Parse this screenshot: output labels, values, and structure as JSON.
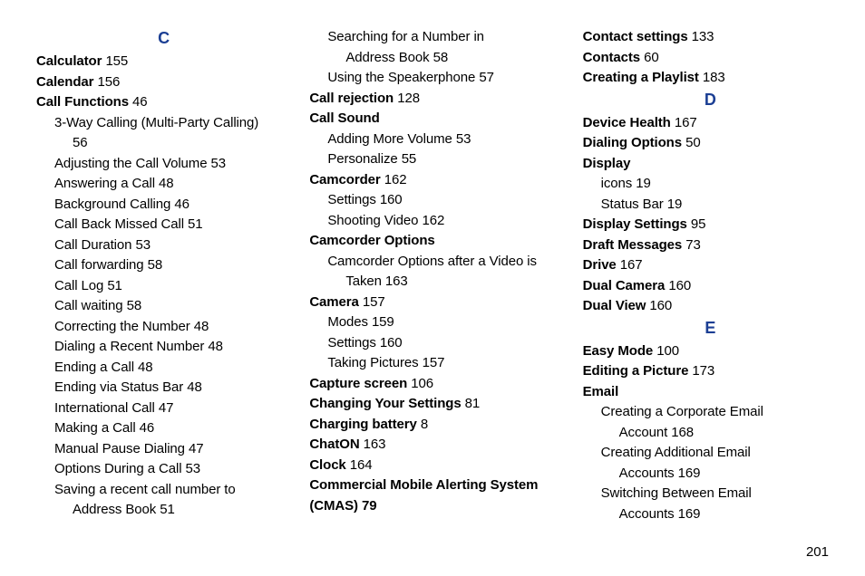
{
  "page_number": "201",
  "columns": [
    {
      "blocks": [
        {
          "type": "letter",
          "text": "C"
        },
        {
          "type": "term",
          "term": "Calculator",
          "page": "155"
        },
        {
          "type": "term",
          "term": "Calendar",
          "page": "156"
        },
        {
          "type": "term",
          "term": "Call Functions",
          "page": "46"
        },
        {
          "type": "sub-wrap",
          "lines": [
            "3-Way Calling (Multi-Party Calling)",
            "56"
          ]
        },
        {
          "type": "sub",
          "text": "Adjusting the Call Volume",
          "page": "53"
        },
        {
          "type": "sub",
          "text": "Answering a Call",
          "page": "48"
        },
        {
          "type": "sub",
          "text": "Background Calling",
          "page": "46"
        },
        {
          "type": "sub",
          "text": "Call Back Missed Call",
          "page": "51"
        },
        {
          "type": "sub",
          "text": "Call Duration",
          "page": "53"
        },
        {
          "type": "sub",
          "text": "Call forwarding",
          "page": "58"
        },
        {
          "type": "sub",
          "text": "Call Log",
          "page": "51"
        },
        {
          "type": "sub",
          "text": "Call waiting",
          "page": "58"
        },
        {
          "type": "sub",
          "text": "Correcting the Number",
          "page": "48"
        },
        {
          "type": "sub",
          "text": "Dialing a Recent Number",
          "page": "48"
        },
        {
          "type": "sub",
          "text": "Ending a Call",
          "page": "48"
        },
        {
          "type": "sub",
          "text": "Ending via Status Bar",
          "page": "48"
        },
        {
          "type": "sub",
          "text": "International Call",
          "page": "47"
        },
        {
          "type": "sub",
          "text": "Making a Call",
          "page": "46"
        },
        {
          "type": "sub",
          "text": "Manual Pause Dialing",
          "page": "47"
        },
        {
          "type": "sub",
          "text": "Options During a Call",
          "page": "53"
        },
        {
          "type": "sub-wrap",
          "lines": [
            "Saving a recent call number to",
            "Address Book 51"
          ]
        }
      ]
    },
    {
      "blocks": [
        {
          "type": "sub-wrap",
          "lines": [
            "Searching for a Number in",
            "Address Book 58"
          ]
        },
        {
          "type": "sub",
          "text": "Using the Speakerphone",
          "page": "57"
        },
        {
          "type": "term",
          "term": "Call rejection",
          "page": "128"
        },
        {
          "type": "term",
          "term": "Call Sound",
          "page": ""
        },
        {
          "type": "sub",
          "text": "Adding More Volume",
          "page": "53"
        },
        {
          "type": "sub",
          "text": "Personalize",
          "page": "55"
        },
        {
          "type": "term",
          "term": "Camcorder",
          "page": "162"
        },
        {
          "type": "sub",
          "text": "Settings",
          "page": "160"
        },
        {
          "type": "sub",
          "text": "Shooting Video",
          "page": "162"
        },
        {
          "type": "term",
          "term": "Camcorder Options",
          "page": ""
        },
        {
          "type": "sub-wrap",
          "lines": [
            "Camcorder Options after a Video is",
            "Taken 163"
          ]
        },
        {
          "type": "term",
          "term": "Camera",
          "page": "157"
        },
        {
          "type": "sub",
          "text": "Modes",
          "page": "159"
        },
        {
          "type": "sub",
          "text": "Settings",
          "page": "160"
        },
        {
          "type": "sub",
          "text": "Taking Pictures",
          "page": "157"
        },
        {
          "type": "term",
          "term": "Capture screen",
          "page": "106"
        },
        {
          "type": "term",
          "term": "Changing Your Settings",
          "page": "81"
        },
        {
          "type": "term",
          "term": "Charging battery",
          "page": "8"
        },
        {
          "type": "term",
          "term": "ChatON",
          "page": "163"
        },
        {
          "type": "term",
          "term": "Clock",
          "page": "164"
        },
        {
          "type": "term-wrap",
          "lines": [
            "Commercial Mobile Alerting System",
            "(CMAS) 79"
          ]
        }
      ]
    },
    {
      "blocks": [
        {
          "type": "term",
          "term": "Contact settings",
          "page": "133"
        },
        {
          "type": "term",
          "term": "Contacts",
          "page": "60"
        },
        {
          "type": "term",
          "term": "Creating a Playlist",
          "page": "183"
        },
        {
          "type": "letter",
          "text": "D"
        },
        {
          "type": "term",
          "term": "Device Health",
          "page": "167"
        },
        {
          "type": "term",
          "term": "Dialing Options",
          "page": "50"
        },
        {
          "type": "term",
          "term": "Display",
          "page": ""
        },
        {
          "type": "sub",
          "text": "icons",
          "page": "19"
        },
        {
          "type": "sub",
          "text": "Status Bar",
          "page": "19"
        },
        {
          "type": "term",
          "term": "Display Settings",
          "page": "95"
        },
        {
          "type": "term",
          "term": "Draft Messages",
          "page": "73"
        },
        {
          "type": "term",
          "term": "Drive",
          "page": "167"
        },
        {
          "type": "term",
          "term": "Dual Camera",
          "page": "160"
        },
        {
          "type": "term",
          "term": "Dual View",
          "page": "160"
        },
        {
          "type": "letter",
          "text": "E"
        },
        {
          "type": "term",
          "term": "Easy Mode",
          "page": "100"
        },
        {
          "type": "term",
          "term": "Editing a Picture",
          "page": "173"
        },
        {
          "type": "term",
          "term": "Email",
          "page": ""
        },
        {
          "type": "sub-wrap",
          "lines": [
            "Creating a Corporate Email",
            "Account 168"
          ]
        },
        {
          "type": "sub-wrap",
          "lines": [
            "Creating Additional Email",
            "Accounts 169"
          ]
        },
        {
          "type": "sub-wrap",
          "lines": [
            "Switching Between Email",
            "Accounts 169"
          ]
        }
      ]
    }
  ]
}
